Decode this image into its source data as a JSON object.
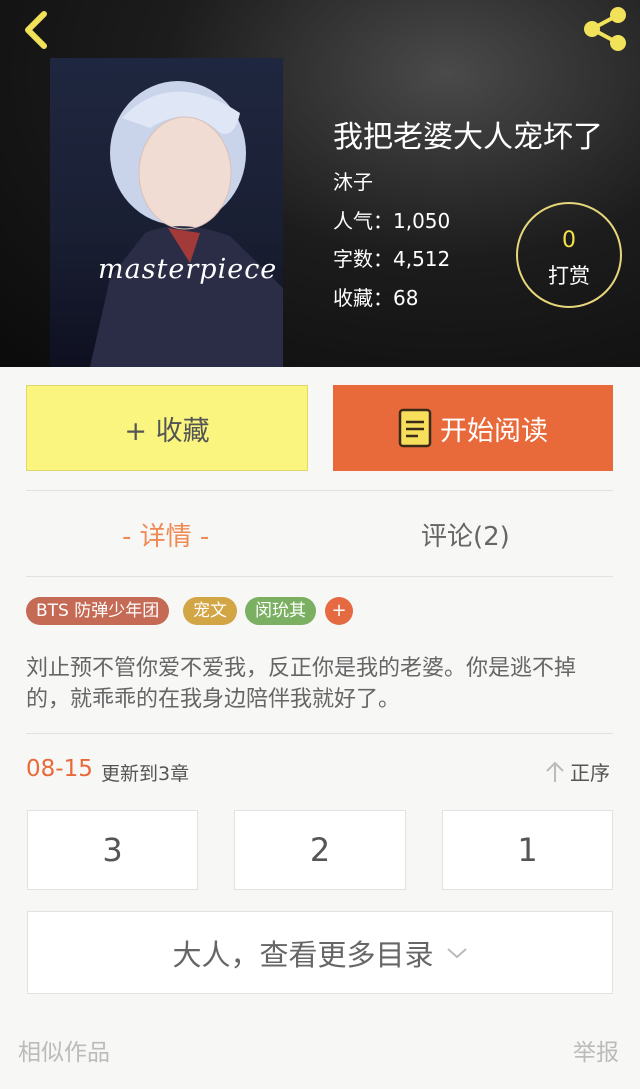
{
  "colors": {
    "accent": "#e8693a",
    "favorite_bg": "#faf57f",
    "reward_ring": "#e8d77a",
    "reward_count": "#f4e44a",
    "tab_active": "#ef8a55"
  },
  "header": {
    "back_icon": "chevron-left-icon",
    "share_icon": "share-icon"
  },
  "book": {
    "cover_text": "masterpiece",
    "title": "我把老婆大人宠坏了",
    "author": "沐子",
    "popularity": "人气：1,050",
    "word_count": "字数：4,512",
    "favorites": "收藏：68",
    "reward_count": "0",
    "reward_label": "打赏"
  },
  "actions": {
    "favorite_label": "+ 收藏",
    "read_label": "开始阅读",
    "read_icon": "book-icon"
  },
  "tabs": [
    {
      "label": "- 详情 -",
      "active": true
    },
    {
      "label": "评论(2)",
      "active": false
    }
  ],
  "tags": [
    {
      "label": "BTS 防弹少年团",
      "color": "#c56a55"
    },
    {
      "label": "宠文",
      "color": "#d2a545"
    },
    {
      "label": "闵玧其",
      "color": "#7bb063"
    }
  ],
  "tag_add_label": "+",
  "synopsis": "刘止预不管你爱不爱我，反正你是我的老婆。你是逃不掉的，就乖乖的在我身边陪伴我就好了。",
  "update": {
    "date": "08-15",
    "text": "更新到3章",
    "sort_label": "正序",
    "sort_icon": "arrow-up-icon"
  },
  "chapters": [
    "3",
    "2",
    "1"
  ],
  "more_chapters_label": "大人，查看更多目录",
  "footer": {
    "similar_label": "相似作品",
    "report_label": "举报"
  }
}
